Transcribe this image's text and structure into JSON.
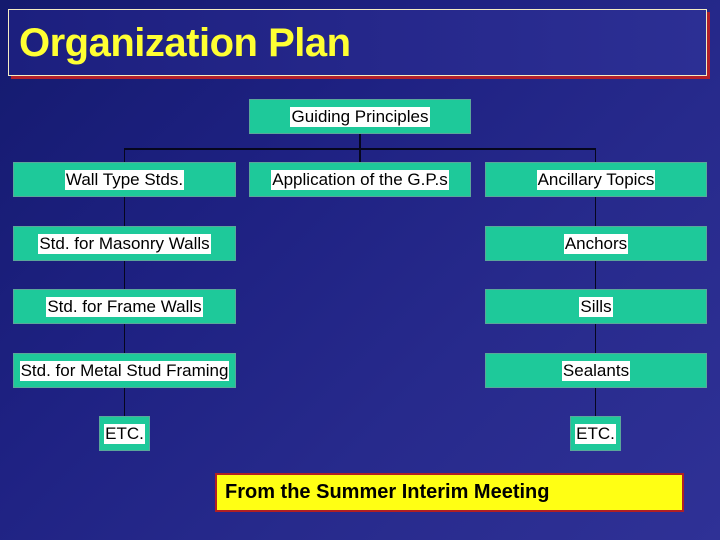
{
  "slide": {
    "title": "Organization Plan",
    "caption": "From the Summer Interim Meeting"
  },
  "colors": {
    "title_text": "#ffff33",
    "node_fill": "#1ec99a",
    "caption_fill": "#ffff14",
    "caption_border": "#b01f24",
    "accent_shadow": "#b3202a"
  },
  "org_chart": {
    "root": "Guiding Principles",
    "level2": {
      "left": "Wall Type Stds.",
      "center": "Application of the G.P.s",
      "right": "Ancillary Topics"
    },
    "left_column": [
      "Std. for Masonry Walls",
      "Std. for Frame Walls",
      "Std. for Metal Stud Framing",
      "ETC."
    ],
    "right_column": [
      "Anchors",
      "Sills",
      "Sealants",
      "ETC."
    ]
  }
}
